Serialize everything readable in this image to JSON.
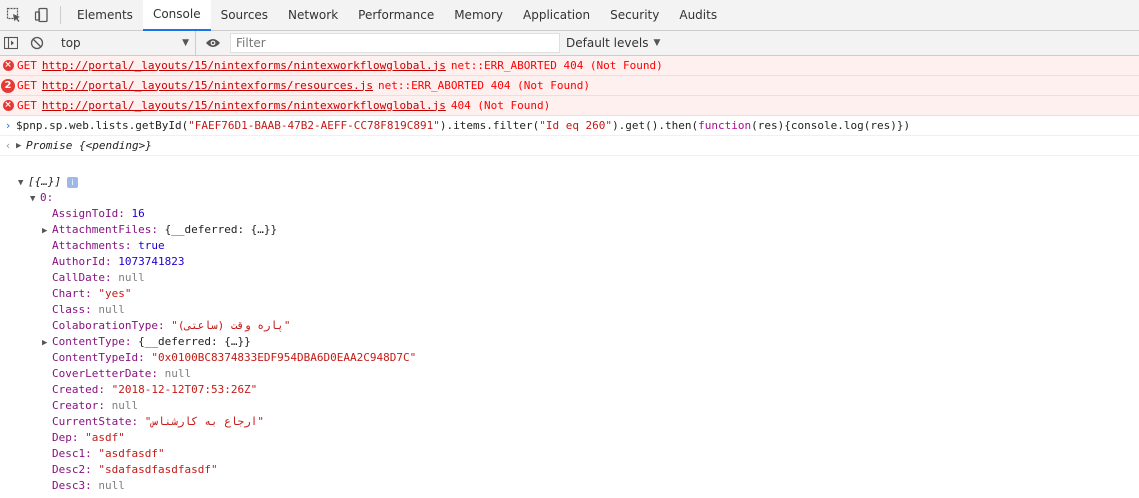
{
  "tabs": [
    "Elements",
    "Console",
    "Sources",
    "Network",
    "Performance",
    "Memory",
    "Application",
    "Security",
    "Audits"
  ],
  "active_tab": "Console",
  "toolbar": {
    "context": "top",
    "filter_placeholder": "Filter",
    "levels": "Default levels"
  },
  "messages": [
    {
      "count": "",
      "method": "GET",
      "url": "http://portal/_layouts/15/nintexforms/nintexworkflowglobal.js",
      "status": "net::ERR_ABORTED 404 (Not Found)"
    },
    {
      "count": "2",
      "method": "GET",
      "url": "http://portal/_layouts/15/nintexforms/resources.js",
      "status": "net::ERR_ABORTED 404 (Not Found)"
    },
    {
      "count": "",
      "method": "GET",
      "url": "http://portal/_layouts/15/nintexforms/nintexworkflowglobal.js",
      "status": "404 (Not Found)"
    }
  ],
  "input": {
    "before": "$pnp.sp.web.lists.getById(",
    "id": "\"FAEF76D1-BAAB-47B2-AEFF-CC78F819C891\"",
    "mid": ").items.filter(",
    "filter": "\"Id eq 260\"",
    "mid2": ").get().then(",
    "kw": "function",
    "after": "(res){console.log(res)})"
  },
  "result": "Promise {<pending>}",
  "tree": {
    "root": "[{…}]",
    "index": "0:",
    "items": [
      {
        "key": "AssignToId",
        "value": "16",
        "type": "num",
        "expandable": false
      },
      {
        "key": "AttachmentFiles",
        "value": "{__deferred: {…}}",
        "type": "obj",
        "expandable": true
      },
      {
        "key": "Attachments",
        "value": "true",
        "type": "bool",
        "expandable": false
      },
      {
        "key": "AuthorId",
        "value": "1073741823",
        "type": "num",
        "expandable": false
      },
      {
        "key": "CallDate",
        "value": "null",
        "type": "null",
        "expandable": false
      },
      {
        "key": "Chart",
        "value": "\"yes\"",
        "type": "str",
        "expandable": false
      },
      {
        "key": "Class",
        "value": "null",
        "type": "null",
        "expandable": false
      },
      {
        "key": "ColaborationType",
        "value": "\"پاره وقت (ساعتی)\"",
        "type": "str",
        "expandable": false
      },
      {
        "key": "ContentType",
        "value": "{__deferred: {…}}",
        "type": "obj",
        "expandable": true
      },
      {
        "key": "ContentTypeId",
        "value": "\"0x0100BC8374833EDF954DBA6D0EAA2C948D7C\"",
        "type": "str",
        "expandable": false
      },
      {
        "key": "CoverLetterDate",
        "value": "null",
        "type": "null",
        "expandable": false
      },
      {
        "key": "Created",
        "value": "\"2018-12-12T07:53:26Z\"",
        "type": "str",
        "expandable": false
      },
      {
        "key": "Creator",
        "value": "null",
        "type": "null",
        "expandable": false
      },
      {
        "key": "CurrentState",
        "value": "\"ارجاع به کارشناس\"",
        "type": "str",
        "expandable": false
      },
      {
        "key": "Dep",
        "value": "\"asdf\"",
        "type": "str",
        "expandable": false
      },
      {
        "key": "Desc1",
        "value": "\"asdfasdf\"",
        "type": "str",
        "expandable": false
      },
      {
        "key": "Desc2",
        "value": "\"sdafasdfasdfasdf\"",
        "type": "str",
        "expandable": false
      },
      {
        "key": "Desc3",
        "value": "null",
        "type": "null",
        "expandable": false
      }
    ]
  }
}
